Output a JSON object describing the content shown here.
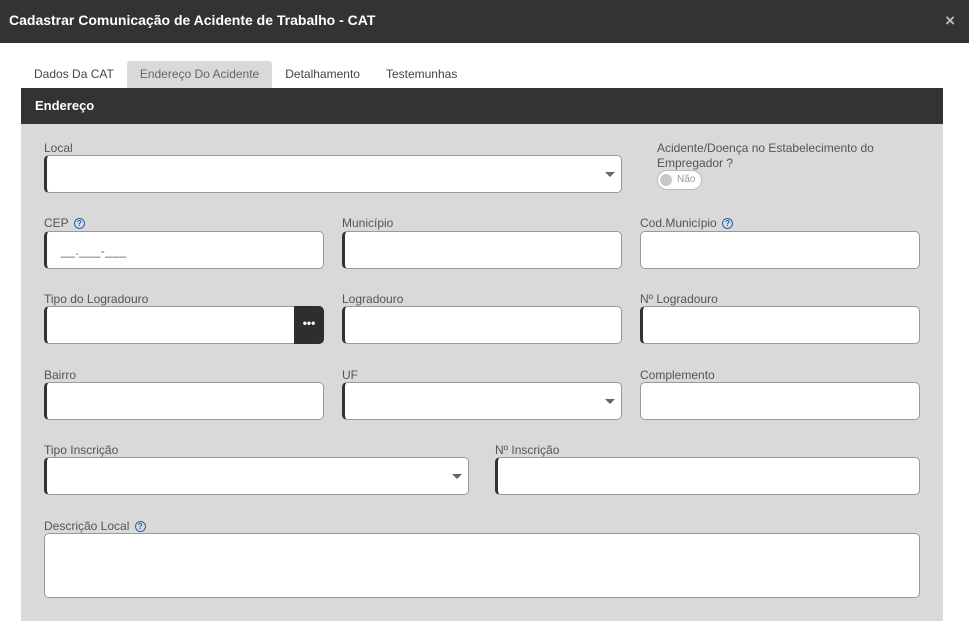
{
  "window": {
    "title": "Cadastrar Comunicação de Acidente de Trabalho - CAT",
    "close_glyph": "×"
  },
  "tabs": [
    {
      "label": "Dados Da CAT",
      "active": false
    },
    {
      "label": "Endereço Do Acidente",
      "active": true
    },
    {
      "label": "Detalhamento",
      "active": false
    },
    {
      "label": "Testemunhas",
      "active": false
    }
  ],
  "section": {
    "title": "Endereço"
  },
  "form": {
    "local": {
      "label": "Local",
      "value": ""
    },
    "acidente_estab": {
      "label_line1": "Acidente/Doença no Estabelecimento do",
      "label_line2": "Empregador ?",
      "toggle_label": "Não",
      "value": false
    },
    "cep": {
      "label": "CEP",
      "mask": "__.___-___",
      "help": "?"
    },
    "municipio": {
      "label": "Município",
      "value": ""
    },
    "cod_municipio": {
      "label": "Cod.Município",
      "help": "?",
      "value": ""
    },
    "tipo_logradouro": {
      "label": "Tipo do Logradouro",
      "value": "",
      "button_glyph": "•••"
    },
    "logradouro": {
      "label": "Logradouro",
      "value": ""
    },
    "nro_logradouro": {
      "label": "Nº Logradouro",
      "value": ""
    },
    "bairro": {
      "label": "Bairro",
      "value": ""
    },
    "uf": {
      "label": "UF",
      "value": ""
    },
    "complemento": {
      "label": "Complemento",
      "value": ""
    },
    "tipo_inscricao": {
      "label": "Tipo Inscrição",
      "value": ""
    },
    "nro_inscricao": {
      "label": "Nº Inscrição",
      "value": ""
    },
    "descricao_local": {
      "label": "Descrição Local",
      "help": "?",
      "value": ""
    }
  },
  "colors": {
    "header_bg": "#333333",
    "panel_bg": "#d9d9d9",
    "help_blue": "#2a5fb0"
  }
}
